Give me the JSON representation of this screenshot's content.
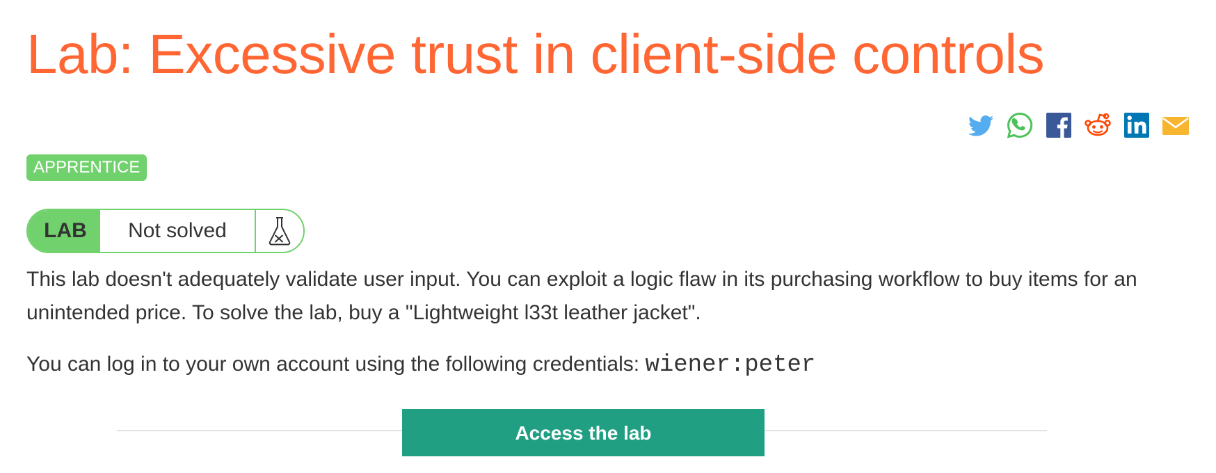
{
  "page": {
    "title": "Lab: Excessive trust in client-side controls"
  },
  "share": {
    "icons": [
      "twitter-icon",
      "whatsapp-icon",
      "facebook-icon",
      "reddit-icon",
      "linkedin-icon",
      "email-icon"
    ],
    "colors": {
      "twitter": "#55acee",
      "whatsapp": "#4ec25a",
      "facebook": "#3b5998",
      "reddit": "#ff4500",
      "linkedin": "#0077b5",
      "email": "#f7b530"
    }
  },
  "level": {
    "label": "APPRENTICE",
    "color": "#70d16d"
  },
  "lab_status": {
    "tag": "LAB",
    "status": "Not solved",
    "icon": "flask-icon",
    "color": "#70d16d"
  },
  "description": "This lab doesn't adequately validate user input. You can exploit a logic flaw in its purchasing workflow to buy items for an unintended price. To solve the lab, buy a \"Lightweight l33t leather jacket\".",
  "credentials": {
    "text": "You can log in to your own account using the following credentials: ",
    "value": "wiener:peter"
  },
  "access": {
    "label": "Access the lab",
    "color": "#219f82"
  },
  "colors": {
    "title": "#ff6633",
    "text": "#333333"
  }
}
